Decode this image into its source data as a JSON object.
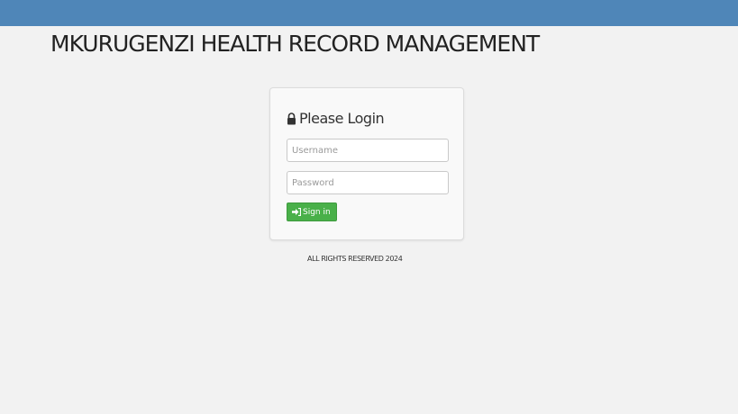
{
  "header": {
    "app_title": "MKURUGENZI HEALTH RECORD MANAGEMENT"
  },
  "login": {
    "heading": "Please Login",
    "heading_icon": "lock-icon",
    "username_placeholder": "Username",
    "username_value": "",
    "password_placeholder": "Password",
    "password_value": "",
    "signin_label": "Sign in",
    "signin_icon": "sign-in-icon"
  },
  "footer": {
    "text": "ALL RIGHTS RESERVED 2024"
  },
  "colors": {
    "topbar": "#4f86b8",
    "background": "#f2f2f2",
    "signin_button": "#49b049"
  }
}
